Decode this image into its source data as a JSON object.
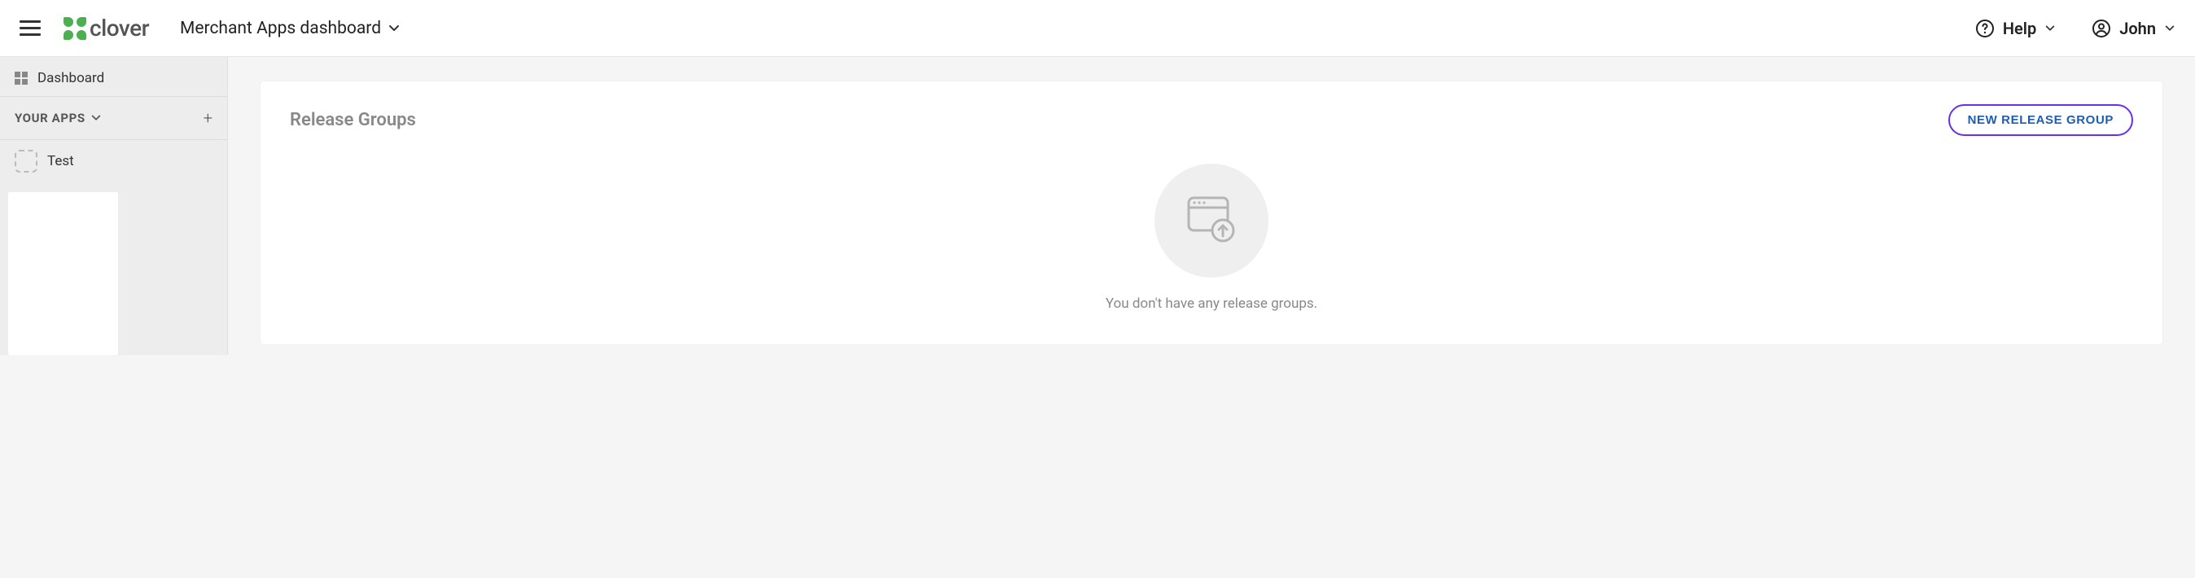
{
  "header": {
    "logo_text": "clover",
    "breadcrumb": "Merchant Apps dashboard",
    "help_label": "Help",
    "user_name": "John"
  },
  "sidebar": {
    "dashboard_label": "Dashboard",
    "section_title": "YOUR APPS",
    "apps": [
      {
        "name": "Test"
      }
    ]
  },
  "main": {
    "card_title": "Release Groups",
    "new_button": "NEW RELEASE GROUP",
    "empty_message": "You don't have any release groups."
  }
}
